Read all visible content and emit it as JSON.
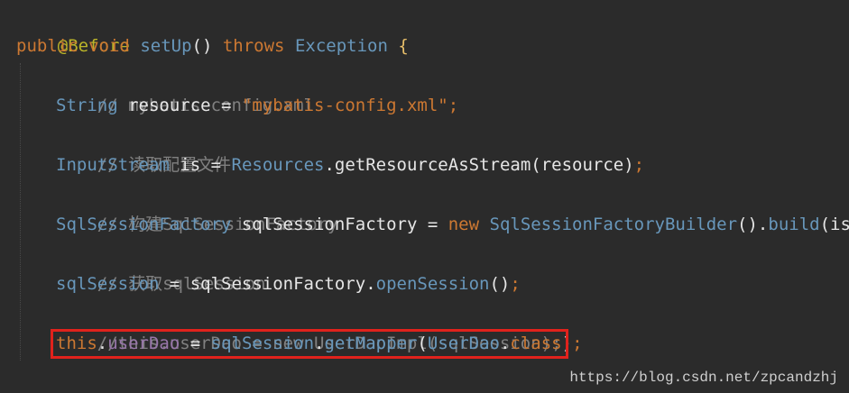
{
  "code": {
    "line1": {
      "annotation": "@Before"
    },
    "line2": {
      "kw_public": "public",
      "kw_void": "void",
      "method_name": "setUp",
      "parens": "()",
      "kw_throws": "throws",
      "exception": "Exception",
      "brace": "{"
    },
    "line3": {
      "comment": "// mybatis-config.xml"
    },
    "line4": {
      "type": "String",
      "ident": "resource",
      "eq": " = ",
      "string": "\"mybatis-config.xml\"",
      "semi": ";"
    },
    "line5": {
      "comment": "// 读取配置文件"
    },
    "line6": {
      "type": "InputStream",
      "ident": "is",
      "eq": " = ",
      "cls": "Resources",
      "dot": ".",
      "method": "getResourceAsStream",
      "args": "(resource)",
      "semi": ";"
    },
    "line7": {
      "comment": "// 构建SqlSessionFactory"
    },
    "line8": {
      "type": "SqlSessionFactory",
      "ident": "sqlSessionFactory",
      "eq": " = ",
      "kw_new": "new",
      "cls": "SqlSessionFactoryBuilder",
      "call": "().",
      "method": "build",
      "args": "(is)",
      "semi": ";"
    },
    "line9": {
      "comment": "// 获取sqlSession"
    },
    "line10": {
      "field": "sqlSession",
      "eq": " = ",
      "ident": "sqlSessionFactory",
      "dot": ".",
      "method": "openSession",
      "args": "()",
      "semi": ";"
    },
    "line11": {
      "comment": "//this.userDao = new UserDaoImpl(sqlSession);"
    },
    "line12": {
      "kw_this": "this",
      "dot1": ".",
      "field": "userDao",
      "eq": " = ",
      "ident": "sqlSession",
      "dot2": ".",
      "method": "getMapper",
      "open": "(",
      "cls": "UserDao",
      "dot3": ".",
      "kw_class": "class",
      "close": ")",
      "semi": ";"
    },
    "line13": {
      "brace": "}"
    }
  },
  "watermark": "https://blog.csdn.net/zpcandzhj",
  "colors": {
    "background": "#2b2b2b",
    "keyword": "#cc7832",
    "type": "#6897bb",
    "comment": "#808080",
    "field": "#9876aa",
    "annotation": "#bbb529",
    "highlight": "#e0221c"
  }
}
